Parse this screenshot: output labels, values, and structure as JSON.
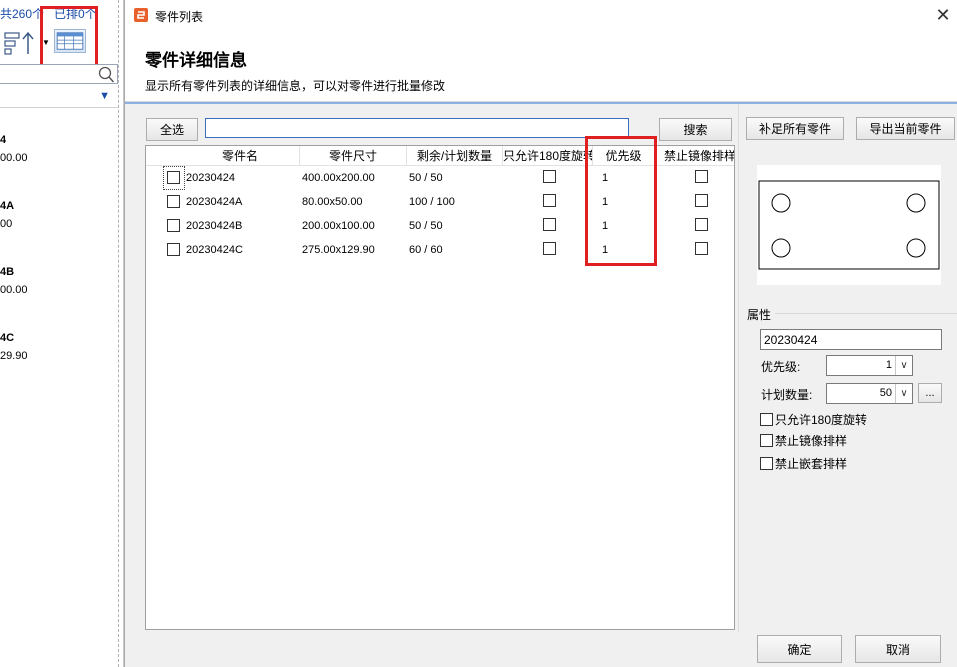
{
  "background_app": {
    "count_text": "共260个",
    "placed_text": "已排0个",
    "items": [
      {
        "name": "4",
        "size": "00.00"
      },
      {
        "name": "4A",
        "size": "00"
      },
      {
        "name": "4B",
        "size": "00.00"
      },
      {
        "name": "4C",
        "size": "29.90"
      }
    ]
  },
  "dialog": {
    "title": "零件列表",
    "close_glyph": "✕",
    "header_title": "零件详细信息",
    "header_desc": "显示所有零件列表的详细信息，可以对零件进行批量修改"
  },
  "toolbar": {
    "select_all_label": "全选",
    "search_value": "",
    "search_label": "搜索",
    "fill_all_label": "补足所有零件",
    "export_label": "导出当前零件"
  },
  "grid": {
    "columns": [
      "零件名",
      "零件尺寸",
      "剩余/计划数量",
      "只允许180度旋转",
      "优先级",
      "禁止镜像排样"
    ],
    "rows": [
      {
        "name": "20230424",
        "size": "400.00x200.00",
        "qty": "50 / 50",
        "priority": "1"
      },
      {
        "name": "20230424A",
        "size": "80.00x50.00",
        "qty": "100 / 100",
        "priority": "1"
      },
      {
        "name": "20230424B",
        "size": "200.00x100.00",
        "qty": "50 / 50",
        "priority": "1"
      },
      {
        "name": "20230424C",
        "size": "275.00x129.90",
        "qty": "60 / 60",
        "priority": "1"
      }
    ]
  },
  "properties": {
    "section_label": "属性",
    "name_value": "20230424",
    "priority_label": "优先级:",
    "priority_value": "1",
    "plan_qty_label": "计划数量:",
    "plan_qty_value": "50",
    "ellipsis_label": "...",
    "opt_rotate180": "只允许180度旋转",
    "opt_no_mirror": "禁止镜像排样",
    "opt_no_nest": "禁止嵌套排样",
    "combo_arrow": "∨"
  },
  "footer": {
    "ok_label": "确定",
    "cancel_label": "取消"
  },
  "colors": {
    "highlight_red": "#e02020",
    "accent_blue": "#3b7bd5",
    "app_icon_orange": "#e8602c"
  }
}
